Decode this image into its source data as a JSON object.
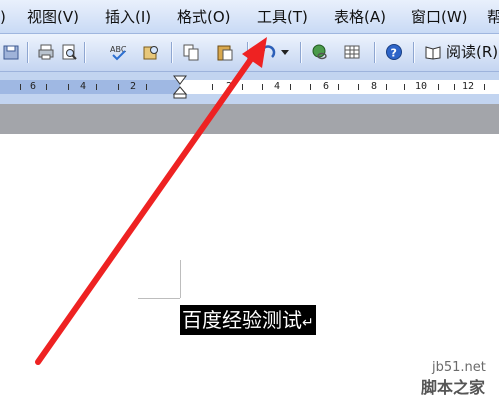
{
  "menubar": {
    "items": [
      {
        "label": ")"
      },
      {
        "label": "视图(V)"
      },
      {
        "label": "插入(I)"
      },
      {
        "label": "格式(O)"
      },
      {
        "label": "工具(T)"
      },
      {
        "label": "表格(A)"
      },
      {
        "label": "窗口(W)"
      },
      {
        "label": "帮"
      }
    ]
  },
  "toolbar": {
    "read_label": "阅读(R)",
    "icons": [
      "save-icon",
      "print-icon",
      "print-preview-icon",
      "spelling-icon",
      "research-icon",
      "copy-icon",
      "paste-icon",
      "undo-icon",
      "dropdown-arrow-icon",
      "hyperlink-icon",
      "table-icon",
      "help-icon",
      "read-icon"
    ]
  },
  "ruler": {
    "labels": [
      "6",
      "4",
      "2",
      "2",
      "4",
      "6",
      "8",
      "10",
      "12"
    ]
  },
  "document": {
    "selected_text": "百度经验测试",
    "paragraph_mark": "↵"
  },
  "annotation": {
    "arrow_color": "#ee2222"
  },
  "watermark": {
    "site": "jb51.net",
    "name": "脚本之家"
  }
}
